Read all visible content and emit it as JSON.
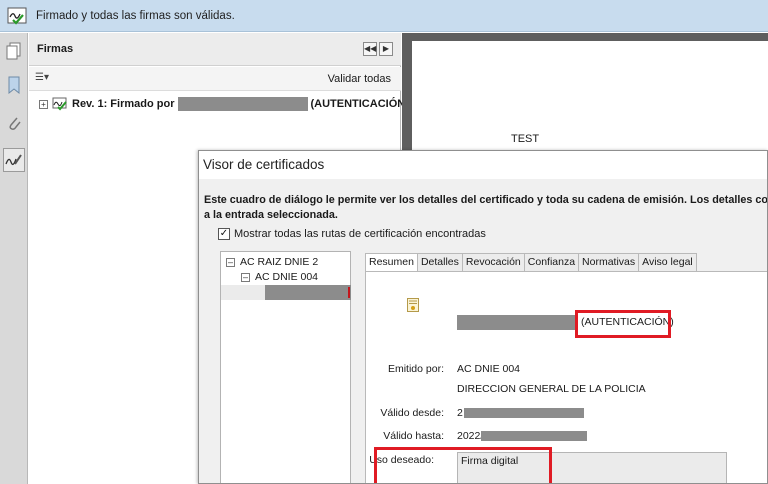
{
  "banner": {
    "message": "Firmado y todas las firmas son válidas."
  },
  "panel": {
    "title": "Firmas",
    "validate_all": "Validar todas",
    "signature": {
      "prefix": "Rev. 1: Firmado por",
      "suffix": "(AUTENTICACIÓN)"
    }
  },
  "document": {
    "text": "TEST"
  },
  "dialog": {
    "title": "Visor de certificados",
    "description_line1": "Este cuadro de diálogo le permite ver los detalles del certificado y toda su cadena de emisión. Los detalles corresponden",
    "description_line2": "a la entrada seleccionada.",
    "show_all_label": "Mostrar todas las rutas de certificación encontradas",
    "tree": [
      "AC RAIZ DNIE 2",
      "AC DNIE 004"
    ],
    "tabs": [
      "Resumen",
      "Detalles",
      "Revocación",
      "Confianza",
      "Normativas",
      "Aviso legal"
    ],
    "summary": {
      "cert_suffix": "(AUTENTICACIÓN)",
      "issued_by_label": "Emitido por:",
      "issued_by_value": "AC DNIE 004",
      "issued_by_org": "DIRECCION GENERAL DE LA POLICIA",
      "valid_from_label": "Válido desde:",
      "valid_from_value": "2",
      "valid_to_label": "Válido hasta:",
      "valid_to_value": "2022/",
      "intended_use_label": "Uso deseado:",
      "intended_use_value": "Firma digital"
    }
  },
  "colors": {
    "highlight": "#e01b24",
    "banner": "#c8dcee",
    "redaction": "#8c8c8c"
  }
}
